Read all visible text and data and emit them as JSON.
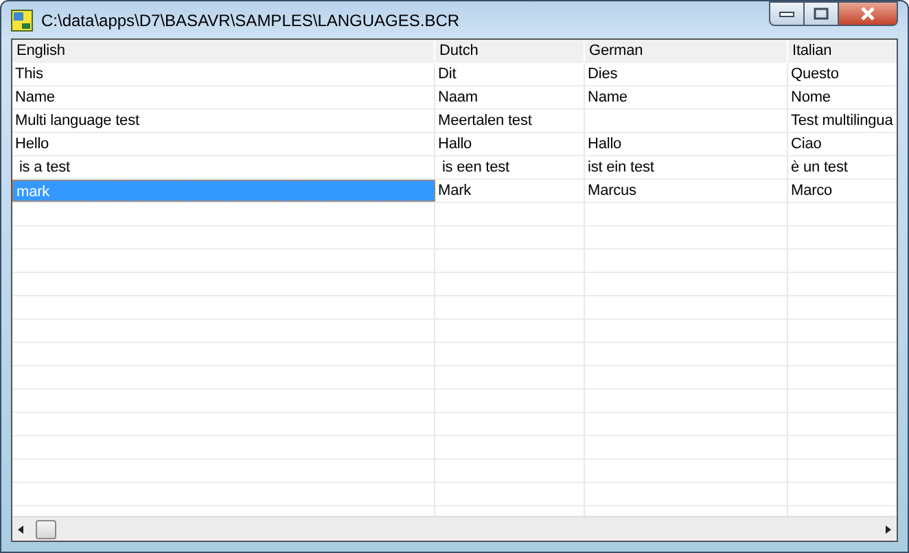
{
  "window": {
    "title": "C:\\data\\apps\\D7\\BASAVR\\SAMPLES\\LANGUAGES.BCR"
  },
  "table": {
    "columns": [
      "English",
      "Dutch",
      "German",
      "Italian"
    ],
    "rows": [
      {
        "cells": [
          "This",
          "Dit",
          "Dies",
          "Questo"
        ],
        "selected": false
      },
      {
        "cells": [
          "Name",
          "Naam",
          "Name",
          "Nome"
        ],
        "selected": false
      },
      {
        "cells": [
          "Multi language test",
          "Meertalen test",
          null,
          "Test multilingua"
        ],
        "selected": false
      },
      {
        "cells": [
          "Hello",
          "Hallo",
          "Hallo",
          "Ciao"
        ],
        "selected": false
      },
      {
        "cells": [
          " is a test",
          " is een test",
          "ist ein test",
          "è un test"
        ],
        "selected": false
      },
      {
        "cells": [
          "mark",
          "Mark",
          "Marcus",
          "Marco"
        ],
        "selected": true
      }
    ]
  }
}
